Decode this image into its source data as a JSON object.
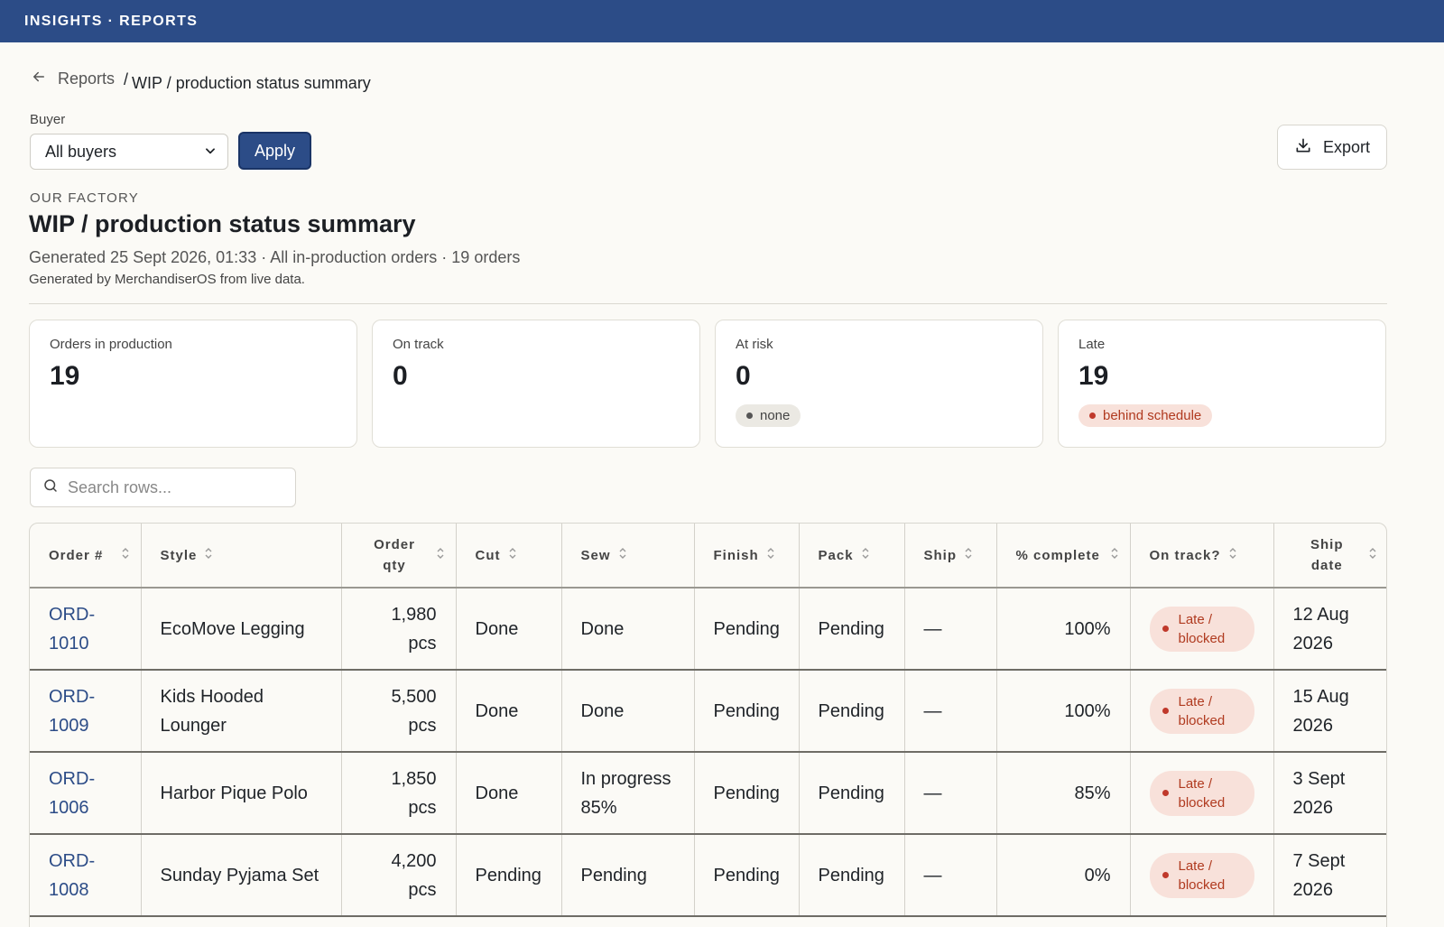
{
  "app": {
    "brand": "INSIGHTS · REPORTS"
  },
  "breadcrumb": {
    "back_label": "Reports",
    "separator": "/",
    "current": "WIP / production status summary"
  },
  "filter": {
    "label": "Buyer",
    "selected": "All buyers",
    "apply_label": "Apply"
  },
  "toolbar": {
    "export_label": "Export"
  },
  "header": {
    "eyebrow": "OUR FACTORY",
    "title": "WIP / production status summary",
    "meta": "Generated 25 Sept 2026, 01:33 · All in-production orders · 19 orders",
    "meta_small": "Generated by MerchandiserOS from live data."
  },
  "cards": [
    {
      "label": "Orders in production",
      "value": "19"
    },
    {
      "label": "On track",
      "value": "0"
    },
    {
      "label": "At risk",
      "value": "0",
      "pill": "none"
    },
    {
      "label": "Late",
      "value": "19",
      "pill": "behind schedule"
    }
  ],
  "search": {
    "placeholder": "Search rows..."
  },
  "table": {
    "columns": [
      "Order #",
      "Style",
      "Order qty",
      "Cut",
      "Sew",
      "Finish",
      "Pack",
      "Ship",
      "% complete",
      "On track?",
      "Ship date"
    ],
    "rows": [
      {
        "order": "ORD-1010",
        "style": "EcoMove Legging",
        "qty": "1,980 pcs",
        "cut": "Done",
        "sew": "Done",
        "finish": "Pending",
        "pack": "Pending",
        "ship": "—",
        "pct": "100%",
        "status": "Late / blocked",
        "ship_date": "12 Aug 2026"
      },
      {
        "order": "ORD-1009",
        "style": "Kids Hooded Lounger",
        "qty": "5,500 pcs",
        "cut": "Done",
        "sew": "Done",
        "finish": "Pending",
        "pack": "Pending",
        "ship": "—",
        "pct": "100%",
        "status": "Late / blocked",
        "ship_date": "15 Aug 2026"
      },
      {
        "order": "ORD-1006",
        "style": "Harbor Pique Polo",
        "qty": "1,850 pcs",
        "cut": "Done",
        "sew": "In progress 85%",
        "finish": "Pending",
        "pack": "Pending",
        "ship": "—",
        "pct": "85%",
        "status": "Late / blocked",
        "ship_date": "3 Sept 2026"
      },
      {
        "order": "ORD-1008",
        "style": "Sunday Pyjama Set",
        "qty": "4,200 pcs",
        "cut": "Pending",
        "sew": "Pending",
        "finish": "Pending",
        "pack": "Pending",
        "ship": "—",
        "pct": "0%",
        "status": "Late / blocked",
        "ship_date": "7 Sept 2026"
      }
    ]
  },
  "colors": {
    "brand": "#2c4c87",
    "danger": "#b03a1f",
    "danger_bg": "#f8e1da",
    "background": "#fbfaf6"
  }
}
